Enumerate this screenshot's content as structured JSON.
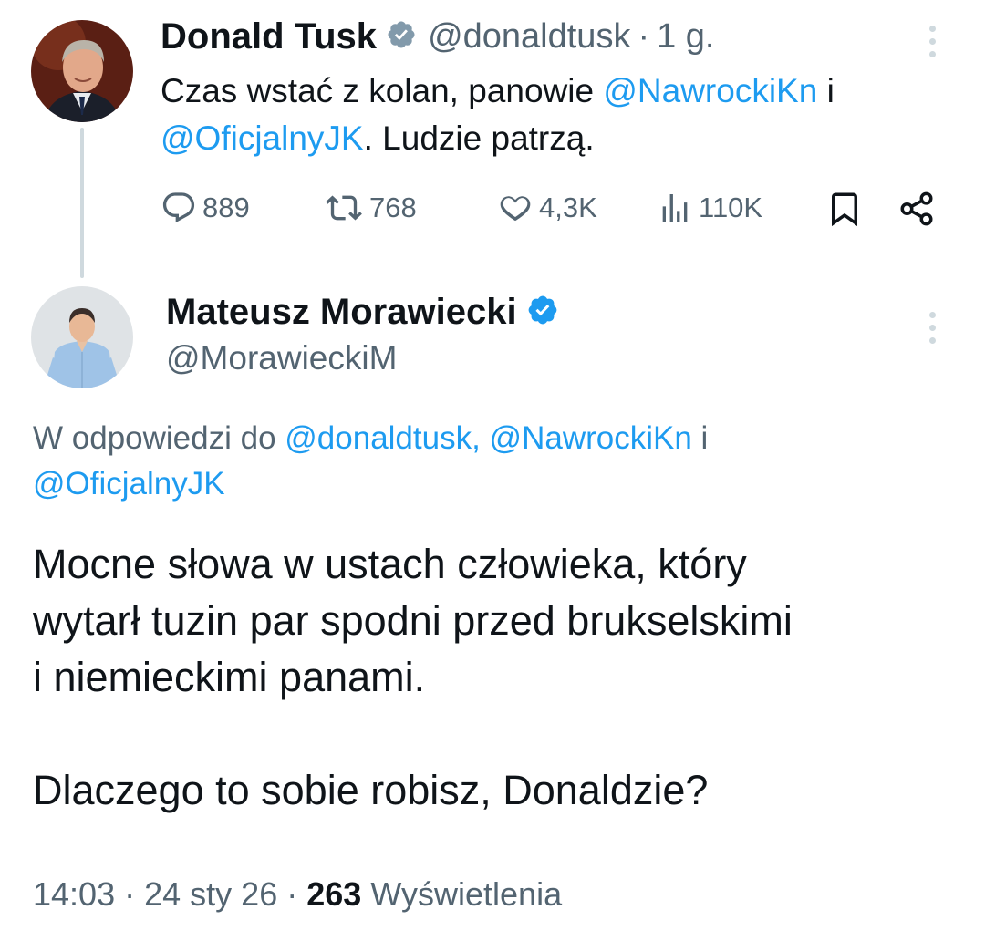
{
  "tusk": {
    "name": "Donald Tusk",
    "handle": "@donaldtusk",
    "separator": "·",
    "time": "1 g.",
    "text_part1": "Czas wstać z kolan, panowie ",
    "mention1": "@NawrockiKn",
    "text_part2": " i",
    "mention2": "@OficjalnyJK",
    "text_part3": ". Ludzie patrzą.",
    "replies": "889",
    "reposts": "768",
    "likes": "4,3K",
    "views": "110K"
  },
  "morawiecki": {
    "name": "Mateusz Morawiecki",
    "handle": "@MorawieckiM",
    "reply_prefix": "W odpowiedzi do ",
    "reply_mention1": "@donaldtusk,",
    "reply_mention2": "@NawrockiKn",
    "reply_join": " i",
    "reply_mention3": "@OficjalnyJK",
    "text": "Mocne słowa w ustach człowieka, który\nwytarł tuzin par spodni przed brukselskimi\ni niemieckimi panami.\n\nDlaczego to sobie robisz, Donaldzie?",
    "time": "14:03",
    "date": "24 sty 26",
    "views_count": "263",
    "views_label": "Wyświetlenia",
    "dot": "·"
  },
  "colors": {
    "accent": "#1d9bf0",
    "muted": "#536471",
    "text": "#0f1419",
    "line": "#cfd9de"
  },
  "icons": [
    "verified-badge-icon",
    "more-icon",
    "reply-icon",
    "repost-icon",
    "like-icon",
    "views-icon",
    "bookmark-icon",
    "share-icon"
  ]
}
